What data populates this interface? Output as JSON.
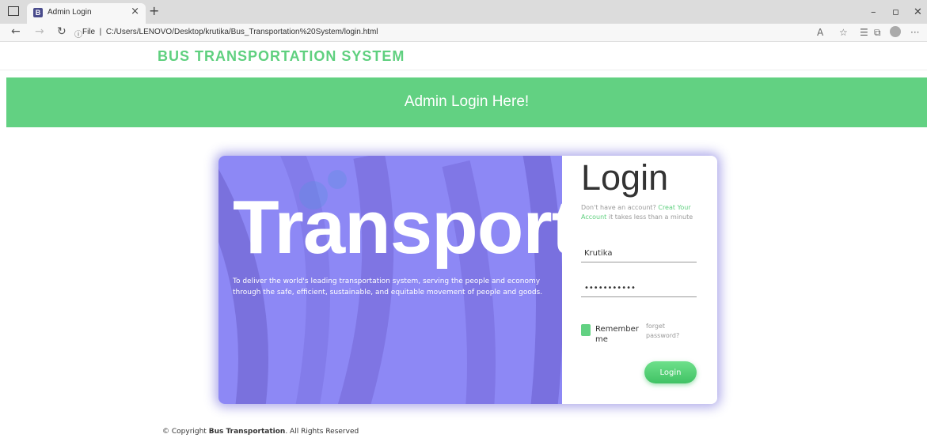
{
  "browser": {
    "tab_title": "Admin Login",
    "tab_favicon": "B",
    "tab_close": "×",
    "new_tab": "+",
    "url_prefix": "File",
    "url": "C:/Users/LENOVO/Desktop/krutika/Bus_Transportation%20System/login.html",
    "icons": [
      "sidebar-icon",
      "back-icon",
      "forward-icon",
      "refresh-icon",
      "info-icon",
      "read-aloud-icon",
      "favorite-add-icon",
      "favorites-icon",
      "collections-icon",
      "profile-icon",
      "more-icon",
      "minimize-icon",
      "restore-icon",
      "close-window-icon"
    ]
  },
  "page": {
    "brand": "BUS TRANSPORTATION SYSTEM",
    "banner_title": "Admin Login Here!",
    "accent_color": "#62d182",
    "hero": {
      "word": "Transport",
      "tagline": "To deliver the world's leading transportation system, serving the people and economy through the safe, efficient, sustainable, and equitable movement of people and goods."
    },
    "login": {
      "heading": "Login",
      "signup_prefix": "Don't have an account?",
      "signup_link": "Creat Your Account",
      "signup_suffix": "it takes less than a minute",
      "username_value": "Krutika",
      "password_value": "•••••••••••",
      "remember_label": "Remember me",
      "forgot_label": "forget password?",
      "button_label": "Login"
    },
    "footer": {
      "prefix": "© Copyright",
      "org": "Bus Transportation",
      "suffix": ". All Rights Reserved"
    }
  }
}
